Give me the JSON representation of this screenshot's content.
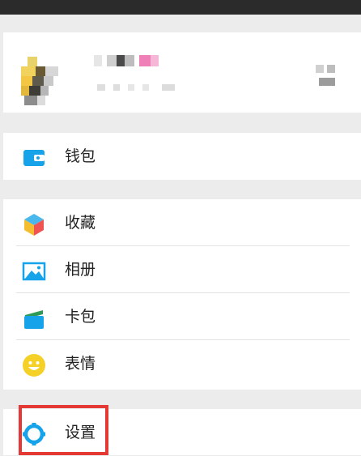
{
  "menu": {
    "wallet_label": "钱包",
    "favorites_label": "收藏",
    "album_label": "相册",
    "cards_label": "卡包",
    "stickers_label": "表情",
    "settings_label": "设置"
  },
  "colors": {
    "accent_blue": "#16a3ea",
    "highlight_red": "#e53935",
    "emoji_yellow": "#f5d128"
  },
  "icons": {
    "wallet": "wallet-icon",
    "favorites": "favorites-cube-icon",
    "album": "album-image-icon",
    "cards": "card-pack-icon",
    "stickers": "smiley-icon",
    "settings": "settings-gear-icon"
  }
}
